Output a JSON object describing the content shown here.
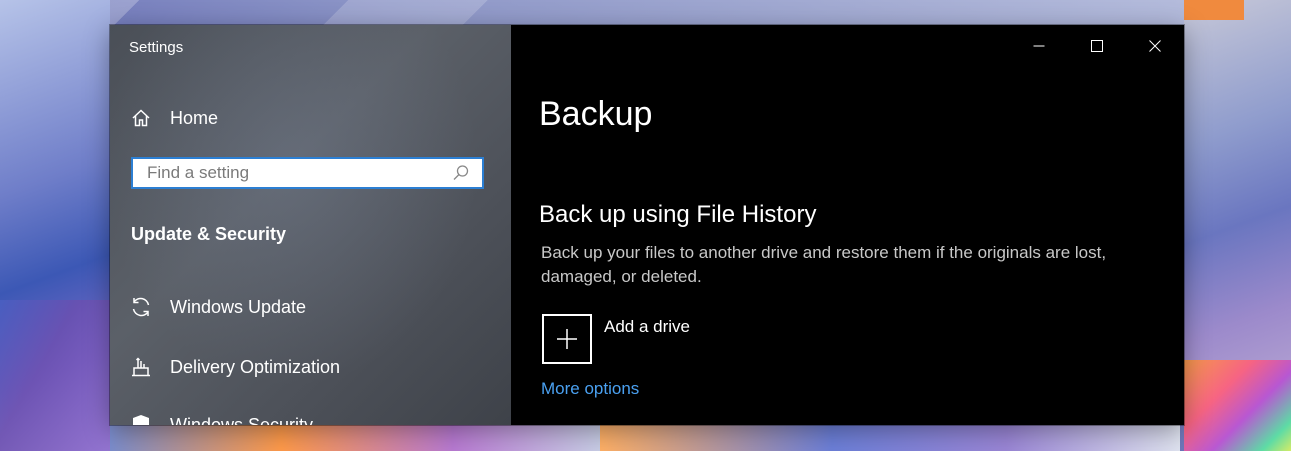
{
  "window": {
    "title": "Settings",
    "controls": {
      "minimize": "minimize-icon",
      "maximize": "maximize-icon",
      "close": "close-icon"
    }
  },
  "sidebar": {
    "home_label": "Home",
    "search_placeholder": "Find a setting",
    "section_heading": "Update & Security",
    "items": [
      {
        "label": "Windows Update",
        "icon": "sync-icon"
      },
      {
        "label": "Delivery Optimization",
        "icon": "delivery-icon"
      },
      {
        "label": "Windows Security",
        "icon": "shield-icon"
      }
    ]
  },
  "main": {
    "title": "Backup",
    "section_heading": "Back up using File History",
    "description": "Back up your files to another drive and restore them if the originals are lost, damaged, or deleted.",
    "add_drive_label": "Add a drive",
    "more_options_label": "More options"
  },
  "colors": {
    "accent": "#4aa0f0",
    "search_border": "#2c7fd3",
    "main_bg": "#000000",
    "sidebar_bg": "#50555d"
  }
}
